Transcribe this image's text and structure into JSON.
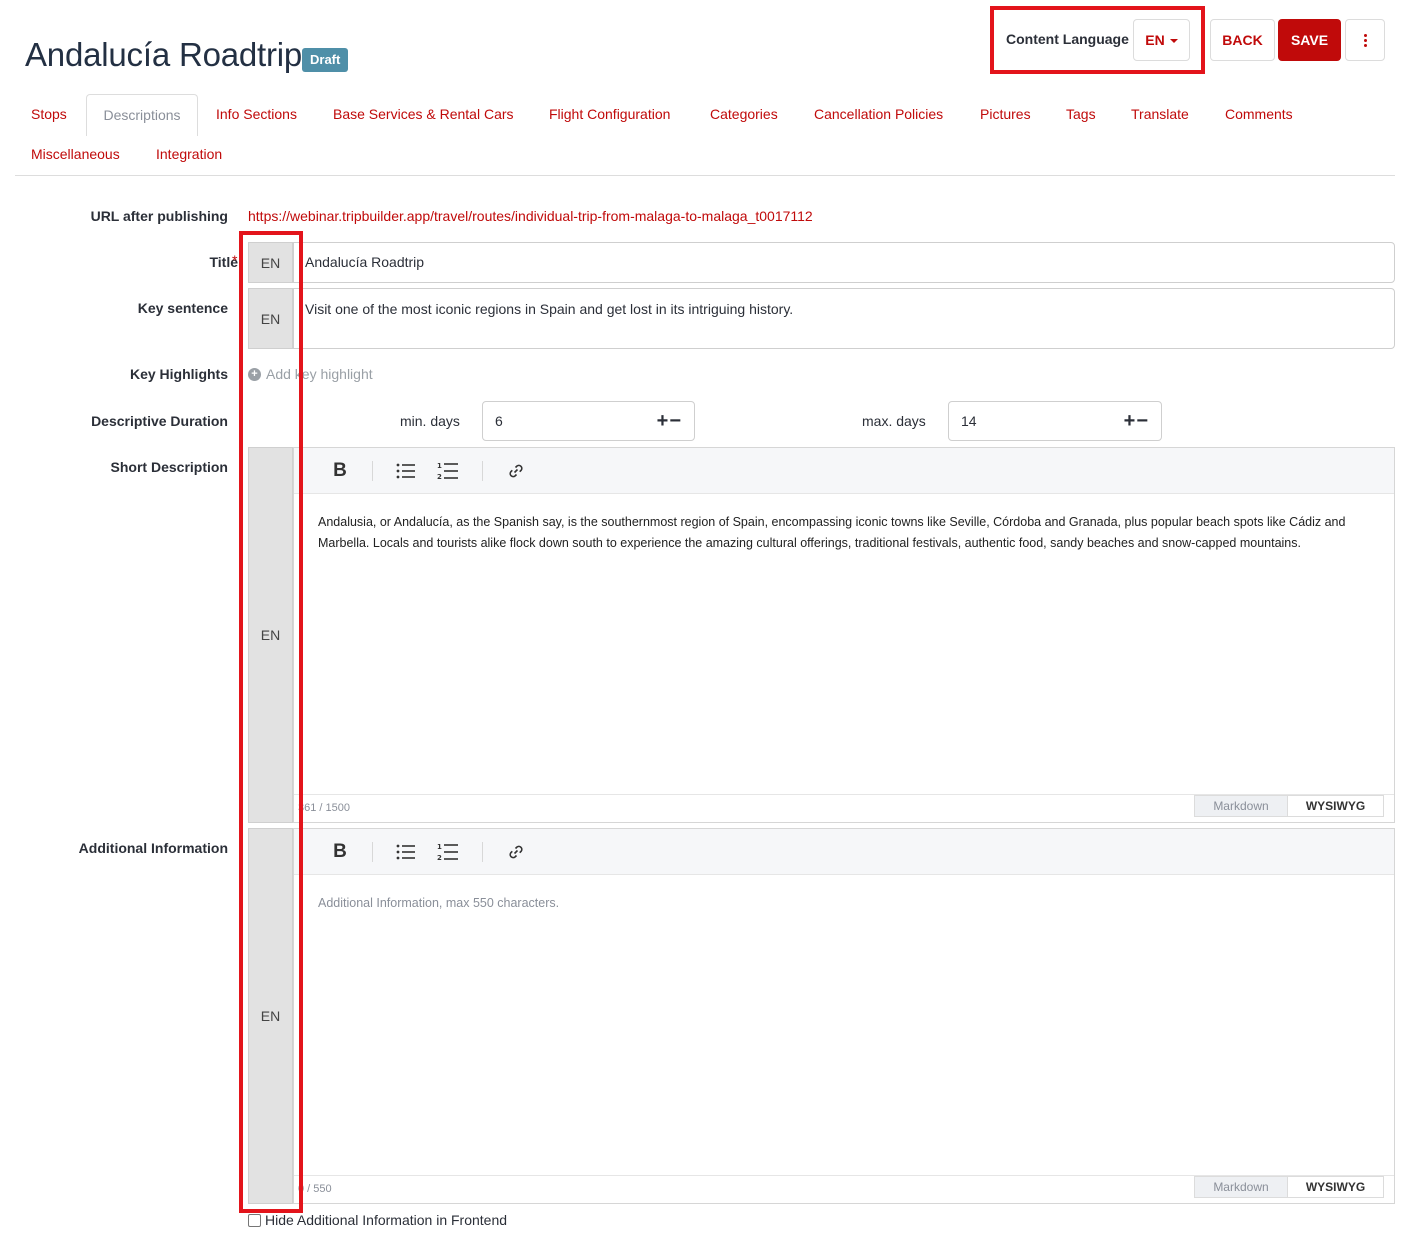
{
  "header": {
    "title": "Andalucía Roadtrip",
    "status_badge": "Draft",
    "content_language_label": "Content Language",
    "content_language_value": "EN",
    "back_label": "BACK",
    "save_label": "SAVE"
  },
  "tabs": [
    "Stops",
    "Descriptions",
    "Info Sections",
    "Base Services & Rental Cars",
    "Flight Configuration",
    "Categories",
    "Cancellation Policies",
    "Pictures",
    "Tags",
    "Translate",
    "Comments",
    "Miscellaneous",
    "Integration"
  ],
  "active_tab": "Descriptions",
  "form": {
    "url_label": "URL after publishing",
    "url_value": "https://webinar.tripbuilder.app/travel/routes/individual-trip-from-malaga-to-malaga_t0017112",
    "title_label": "Title",
    "required_mark": "*",
    "lang_addon": "EN",
    "title_value": "Andalucía Roadtrip",
    "key_sentence_label": "Key sentence",
    "key_sentence_value": "Visit one of the most iconic regions in Spain and get lost in its intriguing history.",
    "key_highlights_label": "Key Highlights",
    "add_key_highlight": "Add key highlight",
    "duration_label": "Descriptive Duration",
    "min_days_label": "min. days",
    "min_days_value": "6",
    "max_days_label": "max. days",
    "max_days_value": "14",
    "stepper": "+−",
    "short_description_label": "Short Description",
    "short_description_value": "Andalusia, or Andalucía, as the Spanish say, is the southernmost region of Spain, encompassing iconic towns like Seville, Córdoba and Granada, plus popular beach spots like Cádiz and Marbella. Locals and tourists alike flock down south to experience the amazing cultural offerings, traditional festivals, authentic food, sandy beaches and snow-capped mountains.",
    "short_description_count": "361 / 1500",
    "additional_info_label": "Additional Information",
    "additional_info_placeholder": "Additional Information, max 550 characters.",
    "additional_info_count": "0 / 550",
    "mode_markdown": "Markdown",
    "mode_wysiwyg": "WYSIWYG",
    "hide_additional_label": "Hide Additional Information in Frontend"
  },
  "icons": {
    "bold": "B",
    "bullet_list": "bullet-list-icon",
    "ordered_list": "ordered-list-icon",
    "link": "link-icon",
    "more": "vertical-dots-icon",
    "add": "plus-circle-icon"
  },
  "colors": {
    "accent": "#c00a0a",
    "badge": "#4f8fa8",
    "highlight_box": "#e3141b",
    "title": "#233043"
  }
}
